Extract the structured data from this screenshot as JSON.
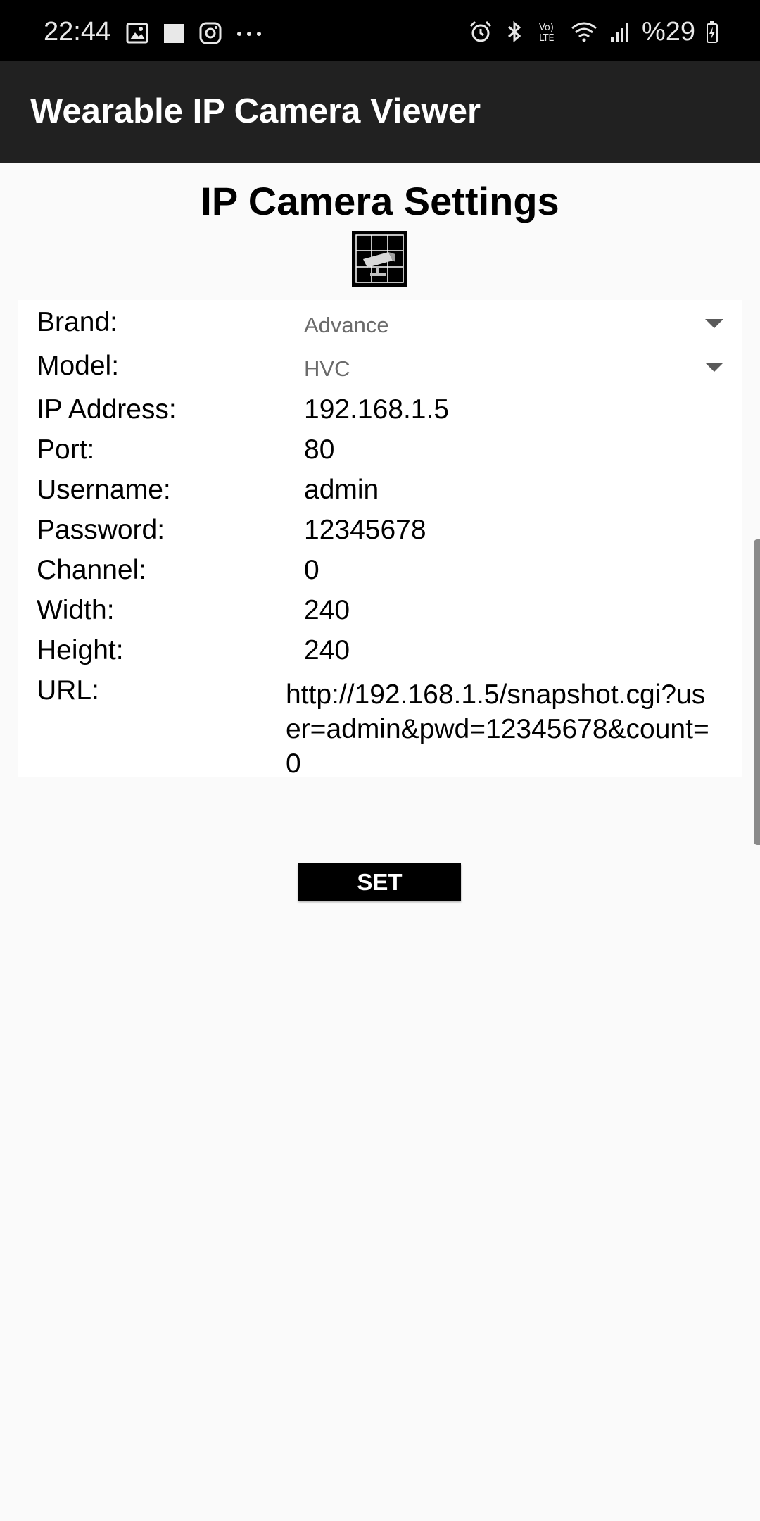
{
  "status_bar": {
    "time": "22:44",
    "battery_text": "%29",
    "left_icons": [
      "image-icon",
      "square-icon",
      "instagram-icon",
      "more-dots-icon"
    ],
    "right_icons": [
      "alarm-icon",
      "bluetooth-icon",
      "volte-icon",
      "wifi-icon",
      "signal-icon",
      "battery-icon"
    ]
  },
  "app_bar": {
    "title": "Wearable IP Camera Viewer",
    "background": "#212121"
  },
  "page": {
    "title": "IP Camera Settings"
  },
  "form": {
    "brand": {
      "label": "Brand:",
      "value": "Advance"
    },
    "model": {
      "label": "Model:",
      "value": "HVC"
    },
    "ip_address": {
      "label": "IP Address:",
      "value": "192.168.1.5"
    },
    "port": {
      "label": "Port:",
      "value": "80"
    },
    "username": {
      "label": "Username:",
      "value": "admin"
    },
    "password": {
      "label": "Password:",
      "value": "12345678"
    },
    "channel": {
      "label": "Channel:",
      "value": "0"
    },
    "width": {
      "label": "Width:",
      "value": "240"
    },
    "height": {
      "label": "Height:",
      "value": "240"
    },
    "url": {
      "label": "URL:",
      "value": "http://192.168.1.5/snapshot.cgi?user=admin&pwd=12345678&count=0"
    }
  },
  "set_button": {
    "label": "SET"
  }
}
